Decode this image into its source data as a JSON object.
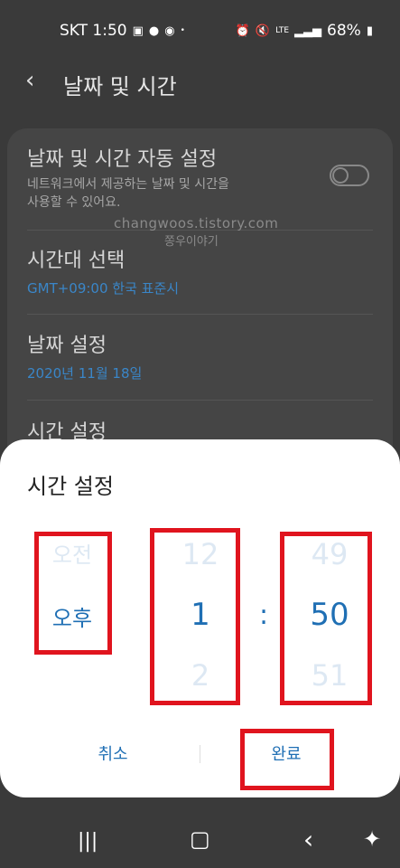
{
  "status": {
    "carrier_time": "SKT 1:50",
    "battery": "68%",
    "left_icons": [
      "image-icon",
      "chat-icon",
      "talk-icon",
      "dot-icon"
    ],
    "right_icons": [
      "alarm-icon",
      "mute-icon",
      "lte-icon",
      "signal-icon",
      "battery-icon"
    ]
  },
  "appbar": {
    "title": "날짜 및 시간"
  },
  "settings": {
    "auto": {
      "title": "날짜 및 시간 자동 설정",
      "subtitle_line1": "네트워크에서 제공하는 날짜 및 시간을",
      "subtitle_line2": "사용할 수 있어요."
    },
    "timezone": {
      "title": "시간대 선택",
      "value": "GMT+09:00 한국 표준시"
    },
    "date": {
      "title": "날짜 설정",
      "value": "2020년 11월 18일"
    },
    "time": {
      "title": "시간 설정"
    },
    "watermark_url": "changwoos.tistory.com",
    "watermark_name": "쫑우이야기"
  },
  "dialog": {
    "title": "시간 설정",
    "ampm": {
      "prev": "오전",
      "selected": "오후"
    },
    "hour": {
      "prev": "12",
      "selected": "1",
      "next": "2"
    },
    "separator": ":",
    "minute": {
      "prev": "49",
      "selected": "50",
      "next": "51"
    },
    "cancel": "취소",
    "done": "완료"
  },
  "colors": {
    "accent": "#1f6fb4",
    "highlight": "#e0141e"
  }
}
